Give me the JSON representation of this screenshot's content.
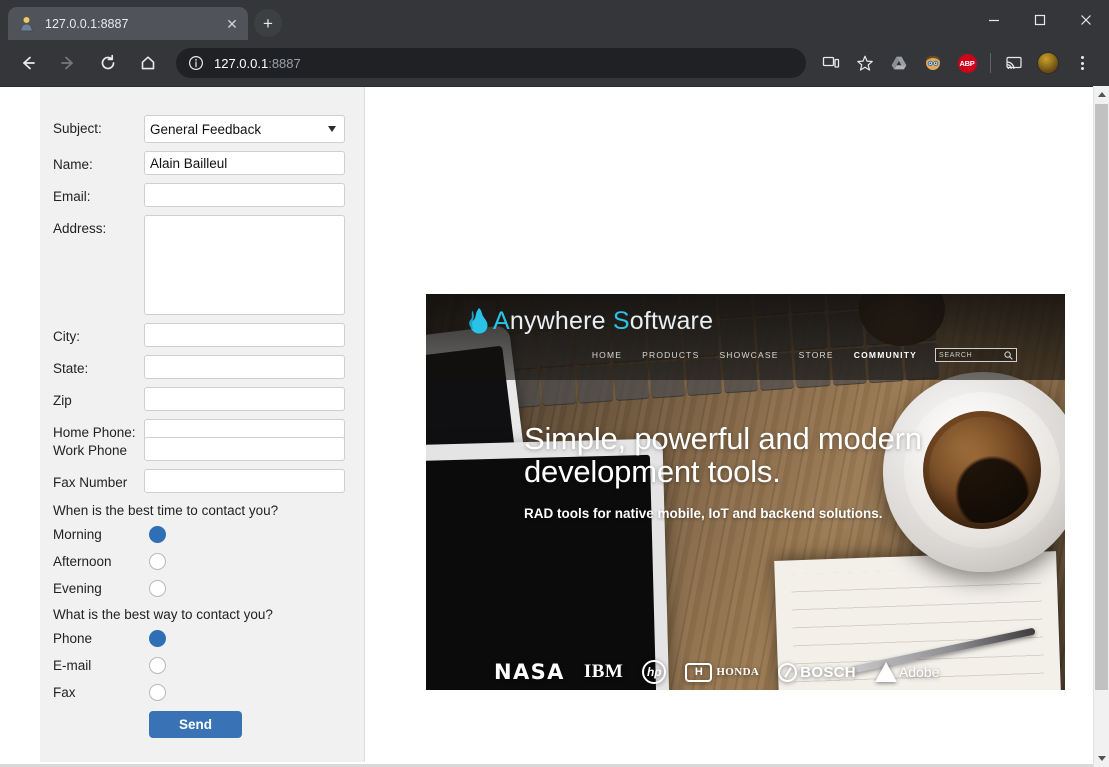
{
  "window": {
    "controls": {
      "minimize": "—",
      "maximize": "▢",
      "close": "✕"
    }
  },
  "tabs": [
    {
      "title": "127.0.0.1:8887",
      "favicon": "person-favicon",
      "close_label": "✕"
    }
  ],
  "new_tab_label": "+",
  "toolbar": {
    "back_label": "←",
    "forward_label": "→",
    "reload_label": "⟳",
    "home_label": "⌂",
    "omnibox": {
      "info_icon": "page-info-icon",
      "host": "127.0.0.1",
      "port": ":8887"
    },
    "icons": [
      {
        "name": "cast-device-icon",
        "label": ""
      },
      {
        "name": "bookmark-star-icon",
        "label": "★"
      },
      {
        "name": "google-drive-icon",
        "label": ""
      },
      {
        "name": "extension-face-icon",
        "label": ""
      },
      {
        "name": "adblock-plus-icon",
        "label": "ABP"
      },
      {
        "name": "cast-icon",
        "label": ""
      },
      {
        "name": "profile-avatar-icon",
        "label": ""
      },
      {
        "name": "chrome-menu-icon",
        "label": "⋮"
      }
    ]
  },
  "form": {
    "fields": [
      {
        "label": "Subject:",
        "type": "select",
        "value": "General Feedback",
        "name": "subject"
      },
      {
        "label": "Name:",
        "type": "text",
        "value": "Alain Bailleul",
        "name": "name"
      },
      {
        "label": "Email:",
        "type": "text",
        "value": "",
        "name": "email"
      },
      {
        "label": "Address:",
        "type": "textarea",
        "value": "",
        "name": "address"
      },
      {
        "label": "City:",
        "type": "text",
        "value": "",
        "name": "city"
      },
      {
        "label": "State:",
        "type": "text",
        "value": "",
        "name": "state"
      },
      {
        "label": "Zip",
        "type": "text",
        "value": "",
        "name": "zip"
      },
      {
        "label": "Home Phone:",
        "type": "text",
        "value": "",
        "name": "home-phone"
      },
      {
        "label": "Work Phone",
        "type": "text",
        "value": "",
        "name": "work-phone"
      },
      {
        "label": "Fax Number",
        "type": "text",
        "value": "",
        "name": "fax-number"
      }
    ],
    "question_time": "When is the best time to contact you?",
    "time_options": [
      {
        "label": "Morning",
        "checked": true
      },
      {
        "label": "Afternoon",
        "checked": false
      },
      {
        "label": "Evening",
        "checked": false
      }
    ],
    "question_way": "What is the best way to contact you?",
    "way_options": [
      {
        "label": "Phone",
        "checked": true
      },
      {
        "label": "E-mail",
        "checked": false
      },
      {
        "label": "Fax",
        "checked": false
      }
    ],
    "send_label": "Send",
    "accent_color": "#3973b5"
  },
  "banner": {
    "logo": {
      "prefix": "A",
      "first": "nywhere ",
      "second_accent": "S",
      "second": "oftware",
      "flame_color": "#29c3e8"
    },
    "nav": [
      {
        "label": "HOME",
        "active": false
      },
      {
        "label": "PRODUCTS",
        "active": false
      },
      {
        "label": "SHOWCASE",
        "active": false
      },
      {
        "label": "STORE",
        "active": false
      },
      {
        "label": "COMMUNITY",
        "active": true
      }
    ],
    "search_placeholder": "SEARCH",
    "hero_title_line1": "Simple, powerful and modern",
    "hero_title_line2": "development tools.",
    "hero_subtitle": "RAD tools for native mobile, IoT and backend solutions.",
    "brands": [
      {
        "name": "NASA",
        "text": "NASA"
      },
      {
        "name": "IBM",
        "text": "IBM"
      },
      {
        "name": "hp",
        "text": "hp"
      },
      {
        "name": "HONDA",
        "text": "HONDA",
        "mark": "H"
      },
      {
        "name": "BOSCH",
        "text": "BOSCH"
      },
      {
        "name": "Adobe",
        "text": "Adobe"
      }
    ]
  },
  "scrollbar": {
    "up_label": "▲",
    "down_label": "▼"
  }
}
